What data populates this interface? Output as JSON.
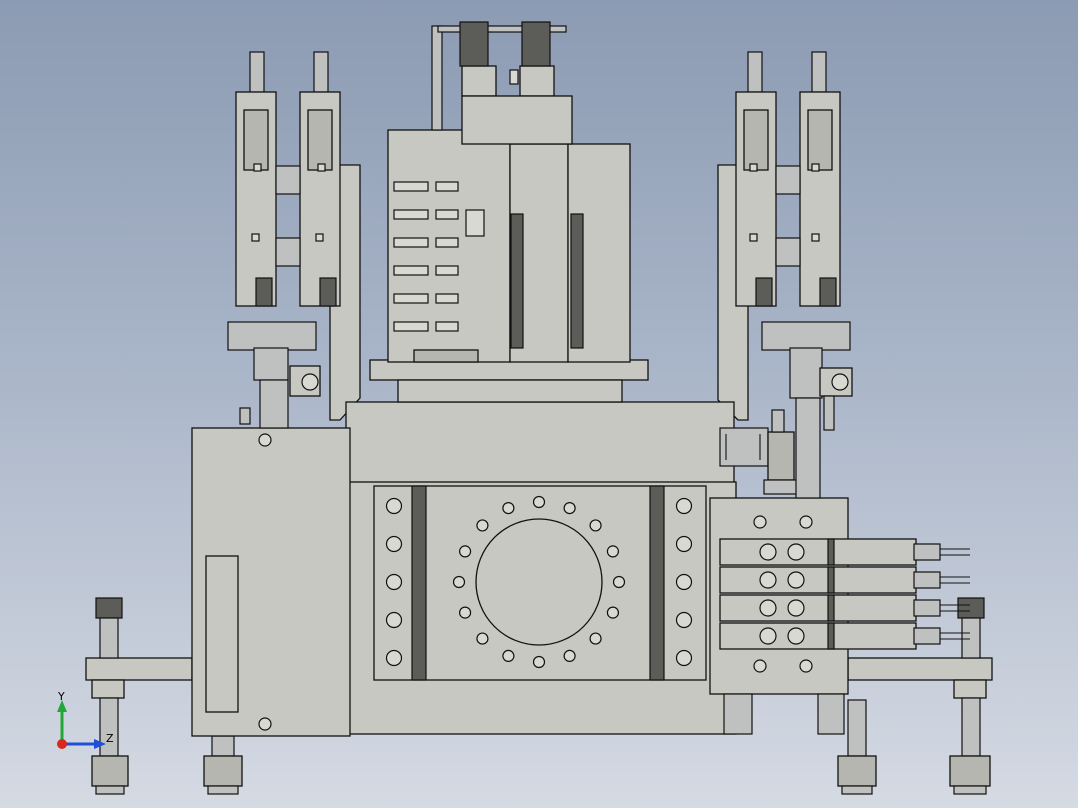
{
  "triad": {
    "y_label": "Y",
    "z_label": "Z",
    "colors": {
      "y": "#22a83a",
      "x": "#d8281f",
      "z": "#1f4fd8"
    }
  }
}
